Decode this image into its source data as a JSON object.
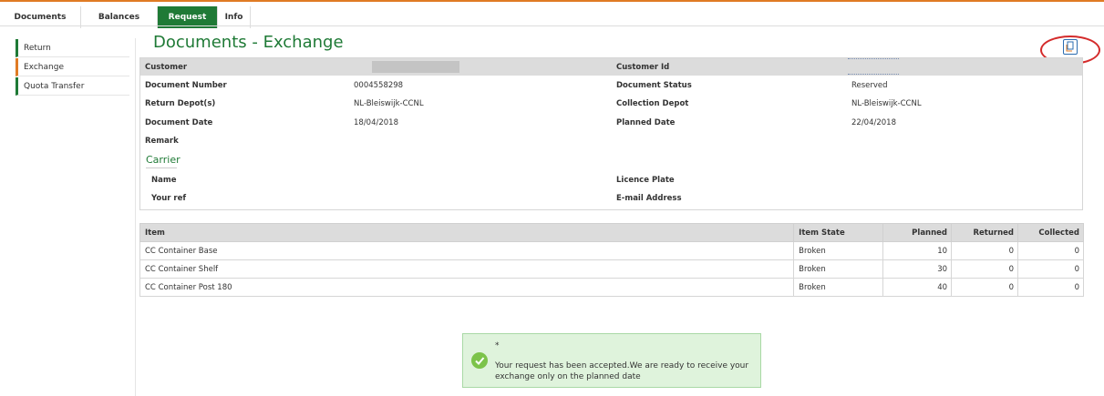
{
  "tabs": [
    {
      "label": "Documents"
    },
    {
      "label": "Balances"
    },
    {
      "label": "Request"
    },
    {
      "label": "Info"
    }
  ],
  "sidebar": {
    "items": [
      {
        "label": "Return"
      },
      {
        "label": "Exchange"
      },
      {
        "label": "Quota Transfer"
      }
    ]
  },
  "page": {
    "title": "Documents - Exchange"
  },
  "document": {
    "customer_label": "Customer",
    "customer_id_label": "Customer Id",
    "document_number_label": "Document Number",
    "document_number": "0004558298",
    "document_status_label": "Document Status",
    "document_status": "Reserved",
    "return_depot_label": "Return Depot(s)",
    "return_depot": "NL-Bleiswijk-CCNL",
    "collection_depot_label": "Collection Depot",
    "collection_depot": "NL-Bleiswijk-CCNL",
    "document_date_label": "Document Date",
    "document_date": "18/04/2018",
    "planned_date_label": "Planned Date",
    "planned_date": "22/04/2018",
    "remark_label": "Remark"
  },
  "carrier": {
    "title": "Carrier",
    "name_label": "Name",
    "licence_plate_label": "Licence Plate",
    "your_ref_label": "Your ref",
    "email_label": "E-mail Address"
  },
  "items_table": {
    "headers": [
      "Item",
      "Item State",
      "Planned",
      "Returned",
      "Collected"
    ],
    "rows": [
      {
        "item": "CC Container Base",
        "state": "Broken",
        "planned": "10",
        "returned": "0",
        "collected": "0"
      },
      {
        "item": "CC Container Shelf",
        "state": "Broken",
        "planned": "30",
        "returned": "0",
        "collected": "0"
      },
      {
        "item": "CC Container Post 180",
        "state": "Broken",
        "planned": "40",
        "returned": "0",
        "collected": "0"
      }
    ]
  },
  "toast": {
    "star": "*",
    "message": "Your request has been accepted.We are ready to receive your exchange only on the planned date",
    "icon": "check-circle-icon"
  },
  "icons": {
    "copy": "copy-document-icon"
  },
  "colors": {
    "brand_green": "#1f7a36",
    "accent_orange": "#e07b24",
    "annotation_red": "#d42b2b",
    "toast_bg": "#dff3dc"
  }
}
